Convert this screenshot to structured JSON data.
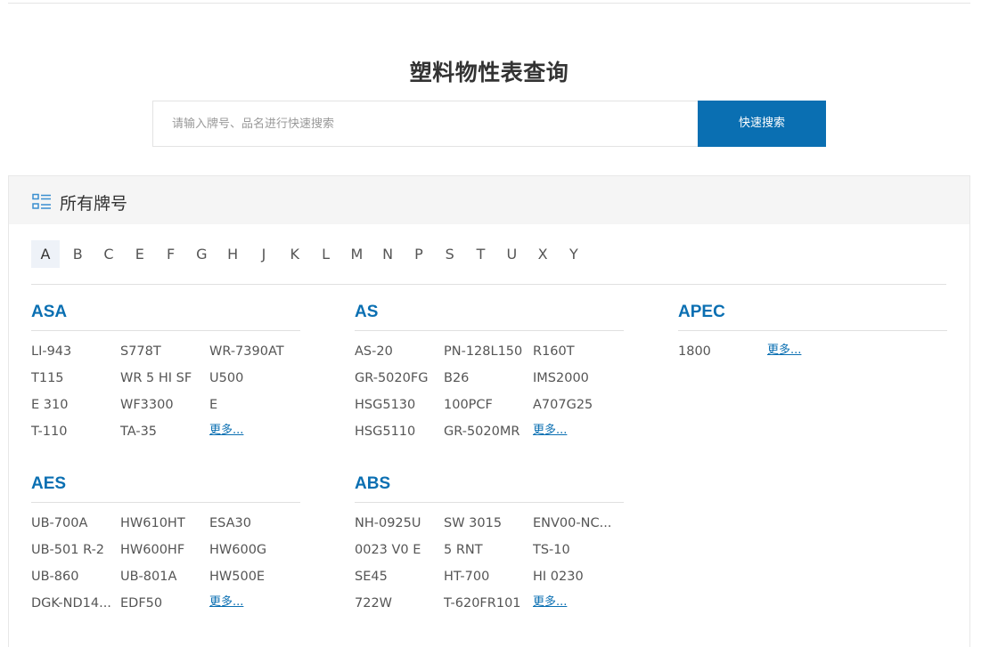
{
  "header": {
    "title": "塑料物性表查询"
  },
  "search": {
    "placeholder": "请输入牌号、品名进行快速搜索",
    "button_label": "快速搜索"
  },
  "panel": {
    "title": "所有牌号",
    "icon": "list-icon"
  },
  "letters": [
    "A",
    "B",
    "C",
    "E",
    "F",
    "G",
    "H",
    "J",
    "K",
    "L",
    "M",
    "N",
    "P",
    "S",
    "T",
    "U",
    "X",
    "Y"
  ],
  "active_letter": "A",
  "more_label": "更多...",
  "accent_color": "#0a6fb2",
  "groups": [
    {
      "name": "ASA",
      "items": [
        "LI-943",
        "S778T",
        "WR-7390AT",
        "T115",
        "WR 5 HI SF",
        "U500",
        "E 310",
        "WF3300",
        "E",
        "T-110",
        "TA-35"
      ]
    },
    {
      "name": "AS",
      "items": [
        "AS-20",
        "PN-128L150",
        "R160T",
        "GR-5020FG",
        "B26",
        "IMS2000",
        "HSG5130",
        "100PCF",
        "A707G25",
        "HSG5110",
        "GR-5020MR"
      ]
    },
    {
      "name": "APEC",
      "items": [
        "1800"
      ]
    },
    {
      "name": "AES",
      "items": [
        "UB-700A",
        "HW610HT",
        "ESA30",
        "UB-501 R-2",
        "HW600HF",
        "HW600G",
        "UB-860",
        "UB-801A",
        "HW500E",
        "DGK-ND14...",
        "EDF50"
      ]
    },
    {
      "name": "ABS",
      "items": [
        "NH-0925U",
        "SW 3015",
        "ENV00-NC...",
        "0023 V0 E",
        "5 RNT",
        "TS-10",
        "SE45",
        "HT-700",
        "HI 0230",
        "722W",
        "T-620FR101"
      ]
    }
  ]
}
